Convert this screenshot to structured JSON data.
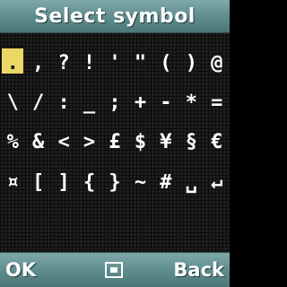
{
  "title": "Select symbol",
  "symbols": [
    ".",
    ",",
    "?",
    "!",
    "'",
    "\"",
    "(",
    ")",
    "@",
    "\\",
    "/",
    ":",
    "_",
    ";",
    "+",
    "-",
    "*",
    "=",
    "%",
    "&",
    "<",
    ">",
    "£",
    "$",
    "¥",
    "§",
    "€",
    "¤",
    "[",
    "]",
    "{",
    "}",
    "~",
    "#",
    "␣",
    "↵",
    "",
    "",
    "",
    "",
    "",
    "",
    "",
    "",
    ""
  ],
  "selected_index": 0,
  "softkeys": {
    "left": "OK",
    "center_icon": "square-select-icon",
    "right": "Back"
  },
  "colors": {
    "bar": "#5d8b8c",
    "highlight": "#ecd764",
    "text": "#ffffff"
  }
}
